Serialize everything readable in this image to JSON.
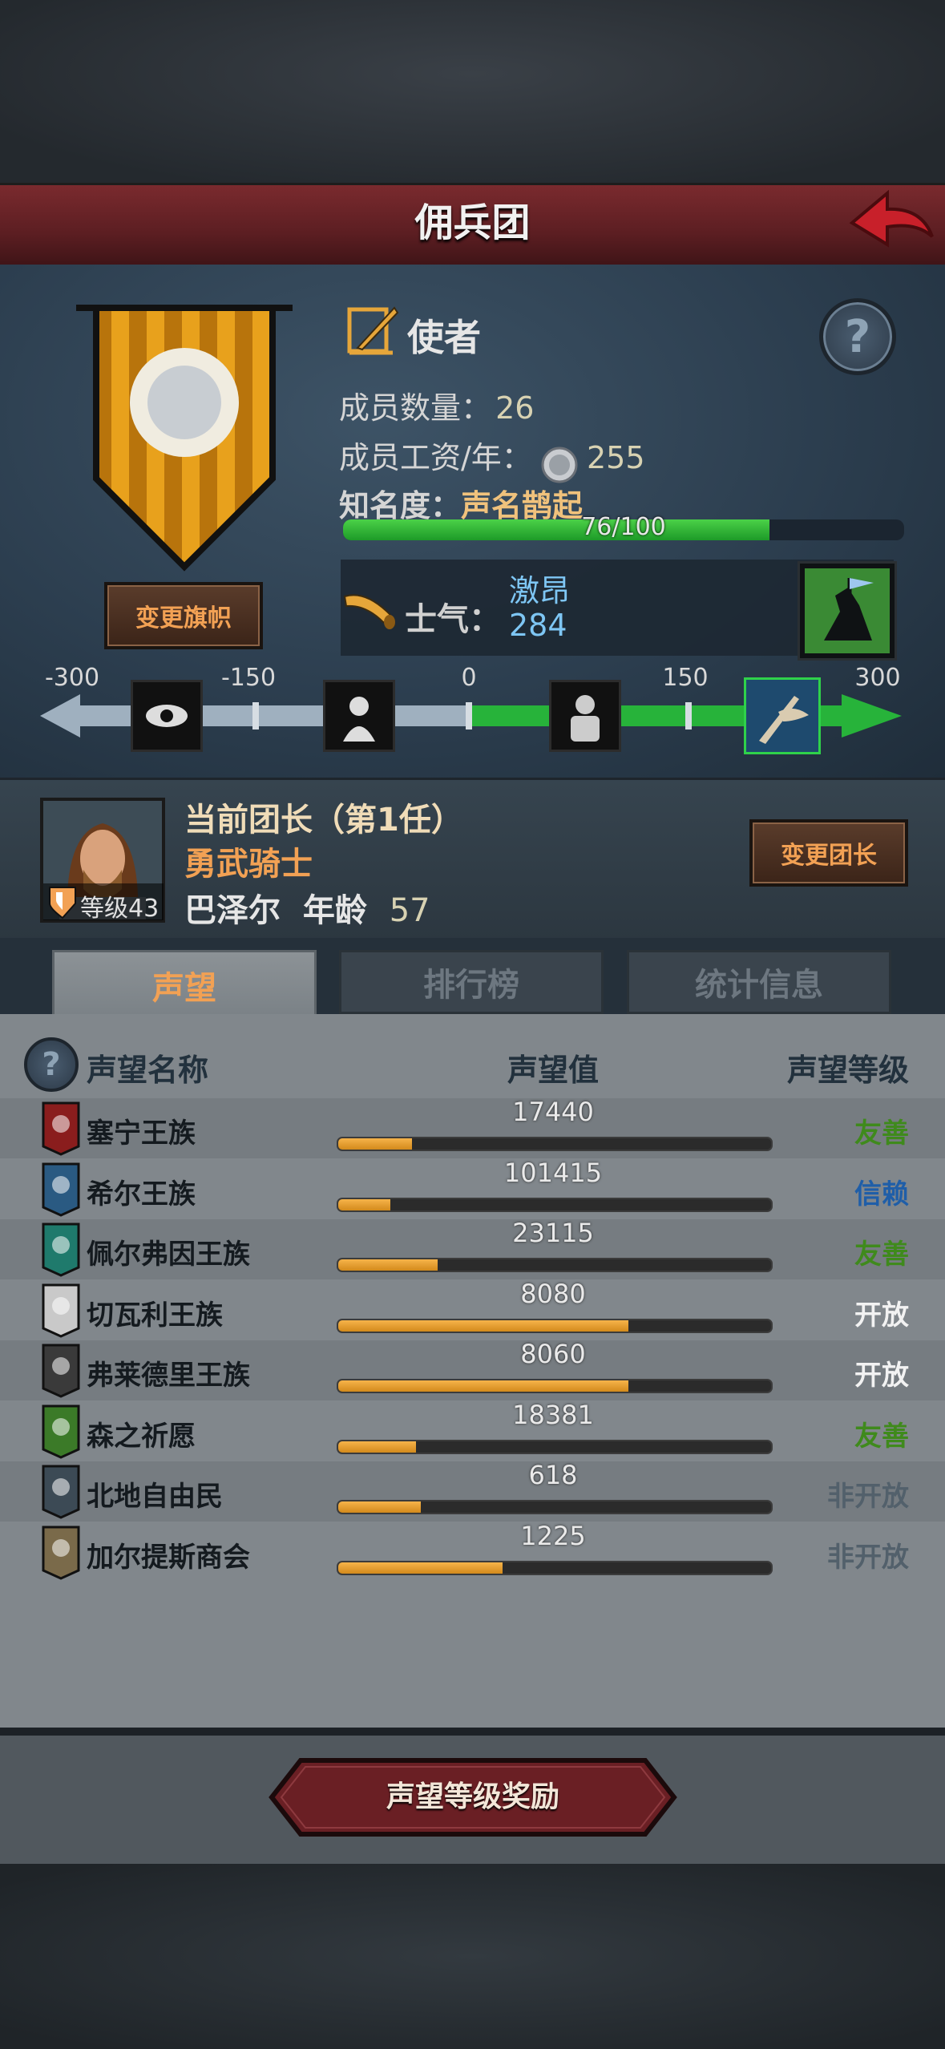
{
  "header": {
    "title": "佣兵团"
  },
  "company": {
    "rank": "使者",
    "members_label": "成员数量：",
    "members_value": "26",
    "salary_label": "成员工资/年：",
    "salary_value": "255",
    "fame_label": "知名度：",
    "fame_value": "声名鹊起",
    "fame_progress": "76/100",
    "fame_fraction": 0.76,
    "change_banner_label": "变更旗帜"
  },
  "morale": {
    "label": "士气：",
    "state": "激昂",
    "value": "284",
    "scale_labels": [
      "-300",
      "-150",
      "0",
      "150",
      "300"
    ]
  },
  "leader": {
    "title": "当前团长（第1任）",
    "class": "勇武骑士",
    "name": "巴泽尔",
    "age_label": "年龄",
    "age": "57",
    "level_label": "等级43",
    "change_leader_label": "变更团长"
  },
  "tabs": [
    "声望",
    "排行榜",
    "统计信息"
  ],
  "table": {
    "headers": {
      "name": "声望名称",
      "value": "声望值",
      "level": "声望等级"
    },
    "rows": [
      {
        "name": "塞宁王族",
        "value": "17440",
        "fraction": 0.17,
        "level": "友善",
        "level_color": "#3f8a1c",
        "icon": "red-dragon-banner-icon"
      },
      {
        "name": "希尔王族",
        "value": "101415",
        "fraction": 0.12,
        "level": "信赖",
        "level_color": "#1f5ea8",
        "icon": "blue-skull-banner-icon"
      },
      {
        "name": "佩尔弗因王族",
        "value": "23115",
        "fraction": 0.23,
        "level": "友善",
        "level_color": "#3f8a1c",
        "icon": "teal-moon-banner-icon"
      },
      {
        "name": "切瓦利王族",
        "value": "8080",
        "fraction": 0.67,
        "level": "开放",
        "level_color": "#f2f2f2",
        "icon": "scales-banner-icon"
      },
      {
        "name": "弗莱德里王族",
        "value": "8060",
        "fraction": 0.67,
        "level": "开放",
        "level_color": "#f2f2f2",
        "icon": "wolf-banner-icon"
      },
      {
        "name": "森之祈愿",
        "value": "18381",
        "fraction": 0.18,
        "level": "友善",
        "level_color": "#3f8a1c",
        "icon": "tree-banner-icon"
      },
      {
        "name": "北地自由民",
        "value": "618",
        "fraction": 0.19,
        "level": "非开放",
        "level_color": "#52606b",
        "icon": "horned-helm-banner-icon"
      },
      {
        "name": "加尔提斯商会",
        "value": "1225",
        "fraction": 0.38,
        "level": "非开放",
        "level_color": "#52606b",
        "icon": "chest-banner-icon"
      }
    ]
  },
  "footer": {
    "reward_label": "声望等级奖励"
  }
}
